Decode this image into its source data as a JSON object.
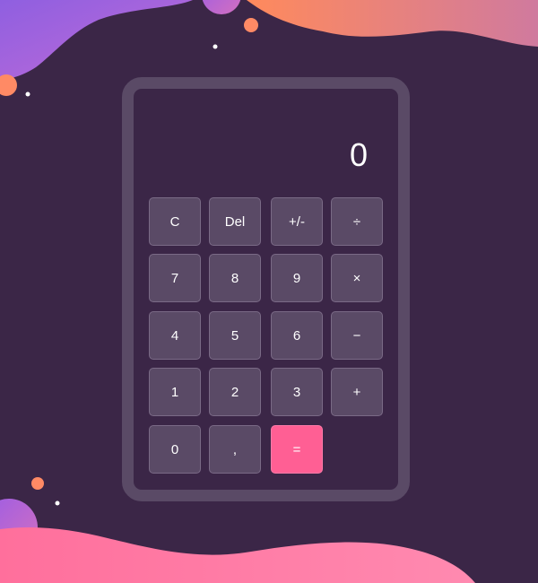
{
  "display": {
    "value": "0"
  },
  "keys": {
    "clear": "C",
    "delete": "Del",
    "sign": "+/-",
    "divide": "÷",
    "seven": "7",
    "eight": "8",
    "nine": "9",
    "multiply": "×",
    "four": "4",
    "five": "5",
    "six": "6",
    "subtract": "−",
    "one": "1",
    "two": "2",
    "three": "3",
    "add": "+",
    "zero": "0",
    "decimal": ",",
    "equals": "="
  },
  "colors": {
    "background": "#3b2647",
    "key": "#5a4a66",
    "equals": "#ff5f94",
    "accent_orange": "#ff8a65",
    "accent_purple": "#9b5de5",
    "accent_pink": "#ff6f9c"
  }
}
